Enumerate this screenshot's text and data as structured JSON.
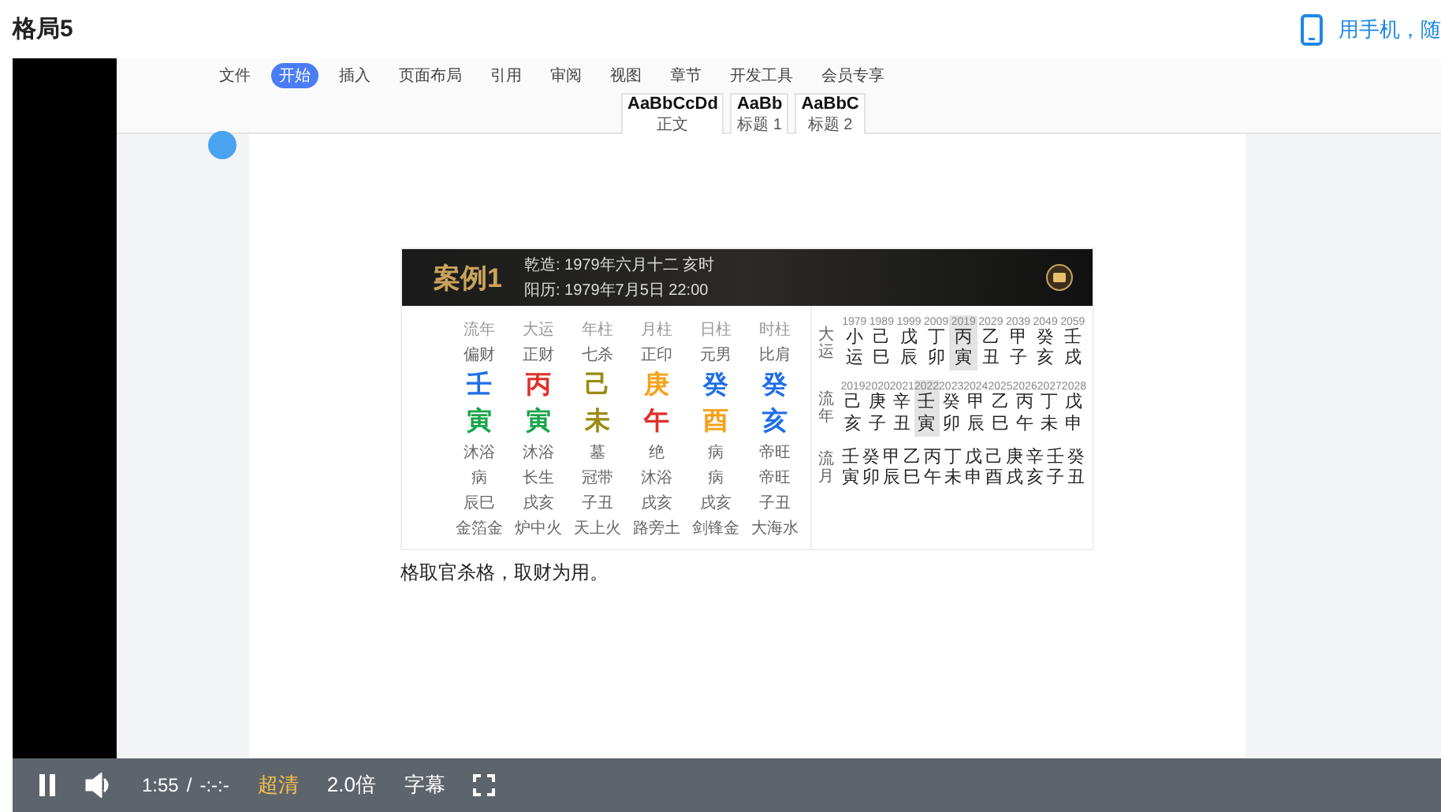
{
  "page_title": "格局5",
  "mobile_link": "用手机，随",
  "editor": {
    "menu": [
      {
        "label": "文件",
        "selected": false
      },
      {
        "label": "开始",
        "selected": true
      },
      {
        "label": "插入",
        "selected": false
      },
      {
        "label": "页面布局",
        "selected": false
      },
      {
        "label": "引用",
        "selected": false
      },
      {
        "label": "审阅",
        "selected": false
      },
      {
        "label": "视图",
        "selected": false
      },
      {
        "label": "章节",
        "selected": false
      },
      {
        "label": "开发工具",
        "selected": false
      },
      {
        "label": "会员专享",
        "selected": false
      }
    ],
    "styles": [
      {
        "sample": "AaBbCcDd",
        "name": "正文"
      },
      {
        "sample": "AaBb",
        "name": "标题 1"
      },
      {
        "sample": "AaBbC",
        "name": "标题 2"
      }
    ]
  },
  "chart": {
    "title": "案例1",
    "info": [
      "乾造: 1979年六月十二 亥时",
      "阳历: 1979年7月5日 22:00"
    ],
    "pillars": [
      {
        "heading": "流年",
        "ten_god": "偏财",
        "stem": {
          "text": "壬",
          "color": "#1f6fe6"
        },
        "branch": {
          "text": "寅",
          "color": "#1aa54a"
        },
        "star_luck": "沐浴",
        "self": "病",
        "void": "辰巳",
        "nayin": "金箔金"
      },
      {
        "heading": "大运",
        "ten_god": "正财",
        "stem": {
          "text": "丙",
          "color": "#e0302a"
        },
        "branch": {
          "text": "寅",
          "color": "#1aa54a"
        },
        "star_luck": "沐浴",
        "self": "长生",
        "void": "戌亥",
        "nayin": "炉中火"
      },
      {
        "heading": "年柱",
        "ten_god": "七杀",
        "stem": {
          "text": "己",
          "color": "#9a8a10"
        },
        "branch": {
          "text": "未",
          "color": "#9a8a10"
        },
        "star_luck": "墓",
        "self": "冠带",
        "void": "子丑",
        "nayin": "天上火"
      },
      {
        "heading": "月柱",
        "ten_god": "正印",
        "stem": {
          "text": "庚",
          "color": "#f5a11c"
        },
        "branch": {
          "text": "午",
          "color": "#e0302a"
        },
        "star_luck": "绝",
        "self": "沐浴",
        "void": "戌亥",
        "nayin": "路旁土"
      },
      {
        "heading": "日柱",
        "ten_god": "元男",
        "stem": {
          "text": "癸",
          "color": "#1f6fe6"
        },
        "branch": {
          "text": "酉",
          "color": "#f5a11c"
        },
        "star_luck": "病",
        "self": "病",
        "void": "戌亥",
        "nayin": "剑锋金"
      },
      {
        "heading": "时柱",
        "ten_god": "比肩",
        "stem": {
          "text": "癸",
          "color": "#1f6fe6"
        },
        "branch": {
          "text": "亥",
          "color": "#1f6fe6"
        },
        "star_luck": "帝旺",
        "self": "帝旺",
        "void": "子丑",
        "nayin": "大海水"
      }
    ],
    "dayun": {
      "label": "大运",
      "cells": [
        {
          "year": "1979",
          "stem": "小",
          "branch": "运",
          "selected": false
        },
        {
          "year": "1989",
          "stem": "己",
          "branch": "巳",
          "selected": false
        },
        {
          "year": "1999",
          "stem": "戊",
          "branch": "辰",
          "selected": false
        },
        {
          "year": "2009",
          "stem": "丁",
          "branch": "卯",
          "selected": false
        },
        {
          "year": "2019",
          "stem": "丙",
          "branch": "寅",
          "selected": true
        },
        {
          "year": "2029",
          "stem": "乙",
          "branch": "丑",
          "selected": false
        },
        {
          "year": "2039",
          "stem": "甲",
          "branch": "子",
          "selected": false
        },
        {
          "year": "2049",
          "stem": "癸",
          "branch": "亥",
          "selected": false
        },
        {
          "year": "2059",
          "stem": "壬",
          "branch": "戌",
          "selected": false
        }
      ]
    },
    "liunian": {
      "label": "流年",
      "cells": [
        {
          "year": "2019",
          "stem": "己",
          "branch": "亥",
          "selected": false
        },
        {
          "year": "2020",
          "stem": "庚",
          "branch": "子",
          "selected": false
        },
        {
          "year": "2021",
          "stem": "辛",
          "branch": "丑",
          "selected": false
        },
        {
          "year": "2022",
          "stem": "壬",
          "branch": "寅",
          "selected": true
        },
        {
          "year": "2023",
          "stem": "癸",
          "branch": "卯",
          "selected": false
        },
        {
          "year": "2024",
          "stem": "甲",
          "branch": "辰",
          "selected": false
        },
        {
          "year": "2025",
          "stem": "乙",
          "branch": "巳",
          "selected": false
        },
        {
          "year": "2026",
          "stem": "丙",
          "branch": "午",
          "selected": false
        },
        {
          "year": "2027",
          "stem": "丁",
          "branch": "未",
          "selected": false
        },
        {
          "year": "2028",
          "stem": "戊",
          "branch": "申",
          "selected": false
        }
      ]
    },
    "liuyue": {
      "label": "流月",
      "cells": [
        {
          "stem": "壬",
          "branch": "寅"
        },
        {
          "stem": "癸",
          "branch": "卯"
        },
        {
          "stem": "甲",
          "branch": "辰"
        },
        {
          "stem": "乙",
          "branch": "巳"
        },
        {
          "stem": "丙",
          "branch": "午"
        },
        {
          "stem": "丁",
          "branch": "未"
        },
        {
          "stem": "戊",
          "branch": "申"
        },
        {
          "stem": "己",
          "branch": "酉"
        },
        {
          "stem": "庚",
          "branch": "戌"
        },
        {
          "stem": "辛",
          "branch": "亥"
        },
        {
          "stem": "壬",
          "branch": "子"
        },
        {
          "stem": "癸",
          "branch": "丑"
        }
      ]
    }
  },
  "caption": "格取官杀格，取财为用。",
  "player": {
    "playing": true,
    "time": "1:55",
    "separator": "/",
    "duration": "-:-:-",
    "quality": "超清",
    "speed": "2.0倍",
    "subtitles": "字幕"
  }
}
